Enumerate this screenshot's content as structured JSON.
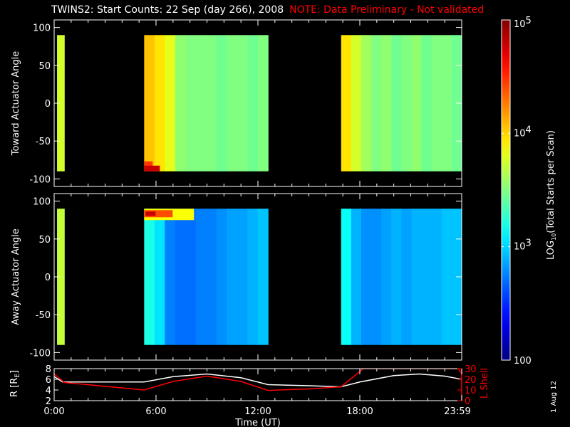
{
  "title": "TWINS2: Start Counts: 22 Sep (day 266), 2008",
  "note": "NOTE: Data Preliminary - Not validated",
  "stamp": "1 Aug 12",
  "chart_data": [
    {
      "type": "heatmap",
      "ylabel": "Toward Actuator Angle",
      "yticks": [
        "100",
        "50",
        "0",
        "-50",
        "-100"
      ],
      "ylim": [
        -110,
        110
      ],
      "angle_range": [
        -90,
        90
      ],
      "blocks": [
        {
          "t0": 0.17,
          "t1": 0.6,
          "log_counts": [
            3.75
          ]
        },
        {
          "t0": 5.3,
          "t1": 12.6,
          "log_counts": [
            4.05,
            3.95,
            3.8,
            3.55,
            3.5,
            3.5,
            3.5,
            3.45,
            3.5,
            3.5,
            3.45,
            3.5
          ],
          "hot_corner": "bottom-left"
        },
        {
          "t0": 16.9,
          "t1": 24,
          "log_counts": [
            3.95,
            3.75,
            3.6,
            3.5,
            3.55,
            3.45,
            3.5,
            3.55,
            3.45,
            3.5,
            3.5,
            3.45
          ],
          "hot_corner": "none"
        }
      ]
    },
    {
      "type": "heatmap",
      "ylabel": "Away Actuator Angle",
      "yticks": [
        "100",
        "50",
        "0",
        "-50",
        "-100"
      ],
      "ylim": [
        -110,
        110
      ],
      "angle_range": [
        -90,
        90
      ],
      "blocks": [
        {
          "t0": 0.17,
          "t1": 0.6,
          "log_counts": [
            3.7
          ]
        },
        {
          "t0": 5.3,
          "t1": 12.6,
          "log_counts": [
            3.2,
            3.05,
            2.75,
            2.7,
            2.7,
            2.75,
            2.75,
            2.8,
            2.85,
            2.85,
            2.9,
            2.95
          ],
          "hot_corner": "top-left"
        },
        {
          "t0": 16.9,
          "t1": 24,
          "log_counts": [
            3.15,
            2.9,
            2.8,
            2.8,
            2.85,
            2.9,
            2.85,
            2.9,
            2.9,
            2.9,
            2.95,
            2.95
          ],
          "hot_corner": "none"
        }
      ]
    },
    {
      "type": "line",
      "xlabel": "Time (UT)",
      "xticks": [
        "0:00",
        "6:00",
        "12:00",
        "18:00",
        "23:59"
      ],
      "ylabel_left": "R [R",
      "ylabel_left_sub": "E",
      "ylabel_left_close": "]",
      "ylabel_right": "L Shell",
      "yticks_left": [
        "8",
        "6",
        "4",
        "2"
      ],
      "yticks_right": [
        "30",
        "20",
        "10",
        "0"
      ],
      "ylim_left": [
        2,
        8
      ],
      "ylim_right": [
        0,
        30
      ],
      "series": [
        {
          "name": "R",
          "color": "#ffffff",
          "x": [
            0,
            0.5,
            5.3,
            7,
            9,
            11,
            12.6,
            15,
            16.9,
            18,
            20,
            21.5,
            23,
            24
          ],
          "y": [
            6.5,
            5.5,
            5.5,
            6.5,
            7,
            6.3,
            5,
            4.8,
            4.6,
            5.5,
            6.7,
            7,
            6.6,
            6
          ]
        },
        {
          "name": "L Shell",
          "color": "#ff0000",
          "x": [
            0,
            0.6,
            5.3,
            7,
            9,
            11,
            12.6,
            15,
            16.9,
            18.2,
            23.8,
            24
          ],
          "y": [
            25,
            17,
            10,
            18,
            23,
            18,
            9.6,
            11,
            13,
            30,
            30,
            25
          ]
        }
      ]
    }
  ],
  "colorbar": {
    "label": "LOG",
    "label_sub": "10",
    "label_rest": "(Total Starts per Scan)",
    "ticks": [
      {
        "base": "10",
        "exp": "5",
        "v": 5
      },
      {
        "base": "10",
        "exp": "4",
        "v": 4
      },
      {
        "base": "10",
        "exp": "3",
        "v": 3
      },
      {
        "base": "100",
        "exp": "",
        "v": 2
      }
    ],
    "range": [
      2,
      5
    ]
  }
}
